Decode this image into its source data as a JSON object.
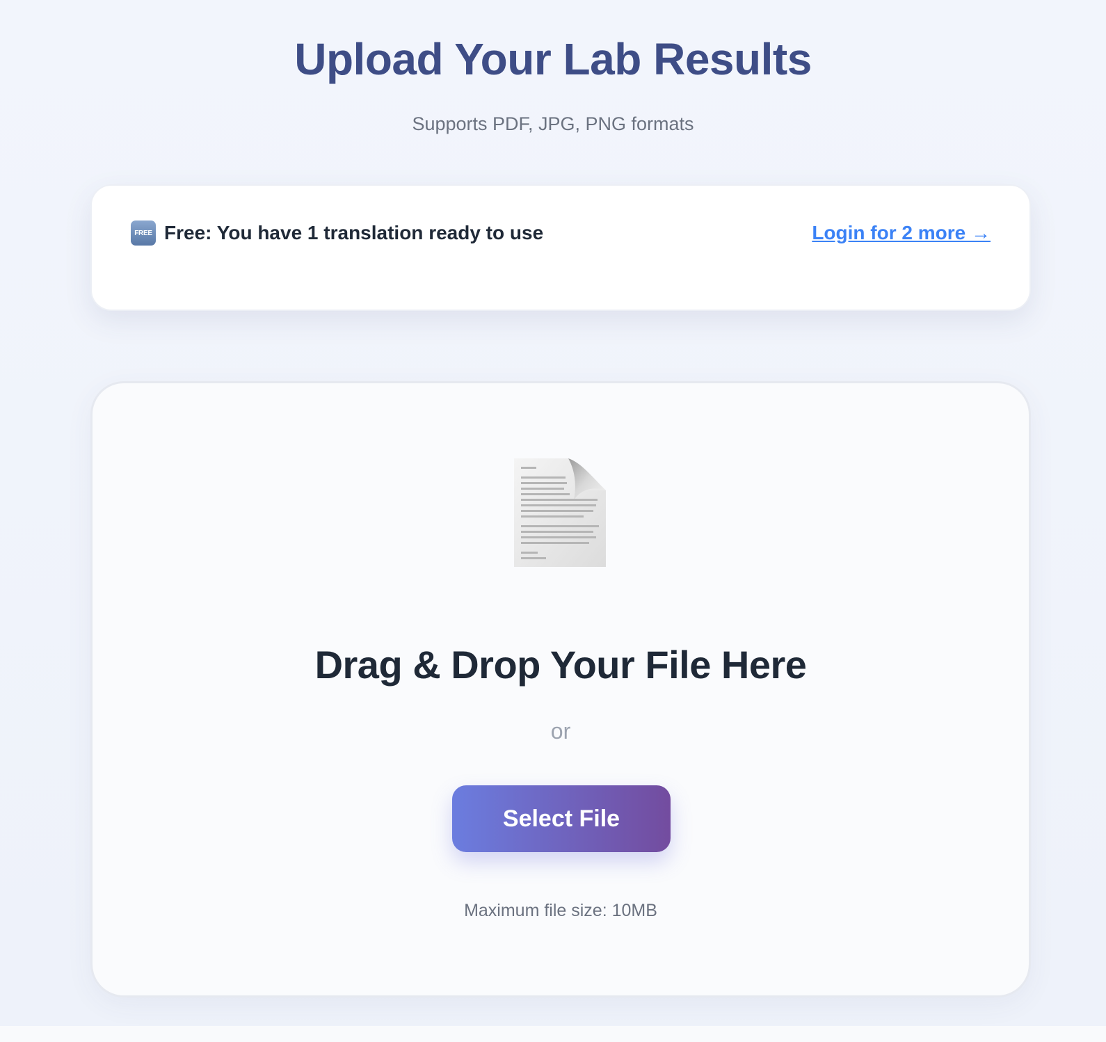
{
  "header": {
    "title": "Upload Your Lab Results",
    "subtitle": "Supports PDF, JPG, PNG formats"
  },
  "banner": {
    "icon": "free-icon",
    "icon_label": "FREE",
    "text": "Free: You have 1 translation ready to use",
    "login_link": "Login for 2 more →"
  },
  "dropzone": {
    "icon": "document-icon",
    "title": "Drag & Drop Your File Here",
    "or": "or",
    "button_label": "Select File",
    "max_size": "Maximum file size: 10MB"
  },
  "colors": {
    "title": "#3e4d86",
    "link": "#3b82f6",
    "button_gradient_start": "#6b7ddf",
    "button_gradient_end": "#734c9f"
  }
}
